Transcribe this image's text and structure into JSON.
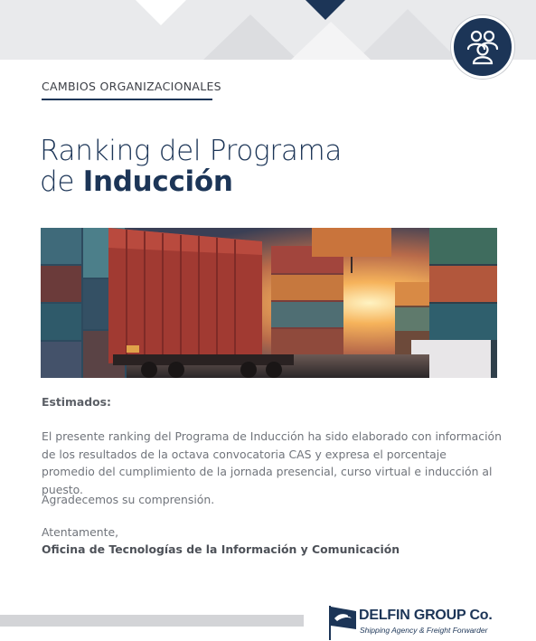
{
  "header": {
    "section_label": "CAMBIOS ORGANIZACIONALES",
    "badge_icon": "people-group-icon",
    "colors": {
      "navy": "#1c3557",
      "band": "#e9eaec"
    }
  },
  "title": {
    "line1": "Ranking del Programa",
    "line2_prefix": "de",
    "line2_bold": "Inducción"
  },
  "image": {
    "icon": "shipping-containers-truck-photo"
  },
  "body": {
    "greeting": "Estimados:",
    "paragraph": "El presente ranking del Programa de Inducción ha sido elaborado con información de los resultados de la octava convocatoria CAS y expresa el porcentaje promedio del cumplimiento de la jornada presencial, curso virtual e inducción al puesto.",
    "thanks": "Agradecemos su comprensión.",
    "closing": "Atentamente,",
    "office": "Oficina de Tecnologías de la Información y Comunicación"
  },
  "footer": {
    "logo_name": "DELFIN GROUP Co.",
    "logo_tagline": "Shipping Agency & Freight Forwarder"
  }
}
